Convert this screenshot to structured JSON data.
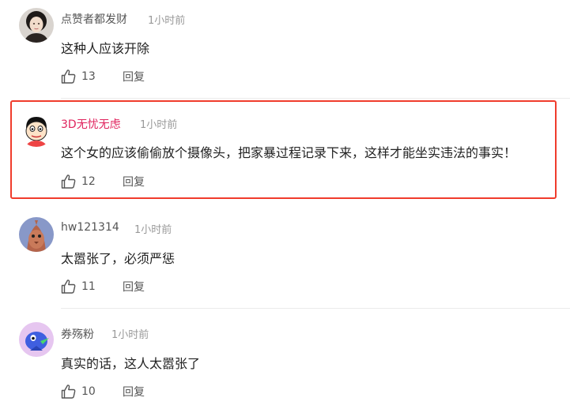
{
  "comments": [
    {
      "username": "点赞者都发财",
      "time": "1小时前",
      "text": "这种人应该开除",
      "likes": "13",
      "reply": "回复",
      "avatar_icon": "woman-portrait-avatar"
    },
    {
      "username": "3D无忧无虑",
      "time": "1小时前",
      "text": "这个女的应该偷偷放个摄像头，把家暴过程记录下来，这样才能坐实违法的事实！",
      "likes": "12",
      "reply": "回复",
      "avatar_icon": "cartoon-boy-avatar",
      "highlighted": true,
      "username_color": "#e0245e",
      "highlight_color": "#f03c2c"
    },
    {
      "username": "hw121314",
      "time": "1小时前",
      "text": "太嚣张了，必须严惩",
      "likes": "11",
      "reply": "回复",
      "avatar_icon": "brown-cartoon-avatar"
    },
    {
      "username": "券殇粉",
      "time": "1小时前",
      "text": "真实的话，这人太嚣张了",
      "likes": "10",
      "reply": "回复",
      "avatar_icon": "blue-bird-avatar"
    }
  ]
}
